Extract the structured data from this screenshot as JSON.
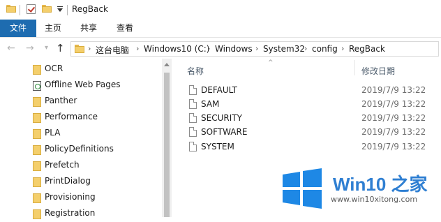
{
  "window": {
    "title": "RegBack"
  },
  "ribbon": {
    "tabs": [
      "文件",
      "主页",
      "共享",
      "查看"
    ]
  },
  "address": {
    "crumbs": [
      "这台电脑",
      "Windows10 (C:)",
      "Windows",
      "System32",
      "config",
      "RegBack"
    ]
  },
  "nav_pane": {
    "items": [
      {
        "label": "OCR",
        "icon": "folder-icon"
      },
      {
        "label": "Offline Web Pages",
        "icon": "web-pages-icon"
      },
      {
        "label": "Panther",
        "icon": "folder-icon"
      },
      {
        "label": "Performance",
        "icon": "folder-icon"
      },
      {
        "label": "PLA",
        "icon": "folder-icon"
      },
      {
        "label": "PolicyDefinitions",
        "icon": "folder-icon"
      },
      {
        "label": "Prefetch",
        "icon": "folder-icon"
      },
      {
        "label": "PrintDialog",
        "icon": "folder-icon"
      },
      {
        "label": "Provisioning",
        "icon": "folder-icon"
      },
      {
        "label": "Registration",
        "icon": "folder-icon"
      }
    ]
  },
  "file_list": {
    "columns": {
      "name": "名称",
      "modified": "修改日期"
    },
    "rows": [
      {
        "name": "DEFAULT",
        "modified": "2019/7/9 13:22"
      },
      {
        "name": "SAM",
        "modified": "2019/7/9 13:22"
      },
      {
        "name": "SECURITY",
        "modified": "2019/7/9 13:22"
      },
      {
        "name": "SOFTWARE",
        "modified": "2019/7/9 13:22"
      },
      {
        "name": "SYSTEM",
        "modified": "2019/7/9 13:22"
      }
    ]
  },
  "watermark": {
    "brand": "Win10 之家",
    "url": "www.win10xitong.com"
  },
  "colors": {
    "ribbon_file_tab": "#1e6cb0",
    "folder": "#f4cf6c",
    "watermark_blue": "#2f7fd2"
  }
}
